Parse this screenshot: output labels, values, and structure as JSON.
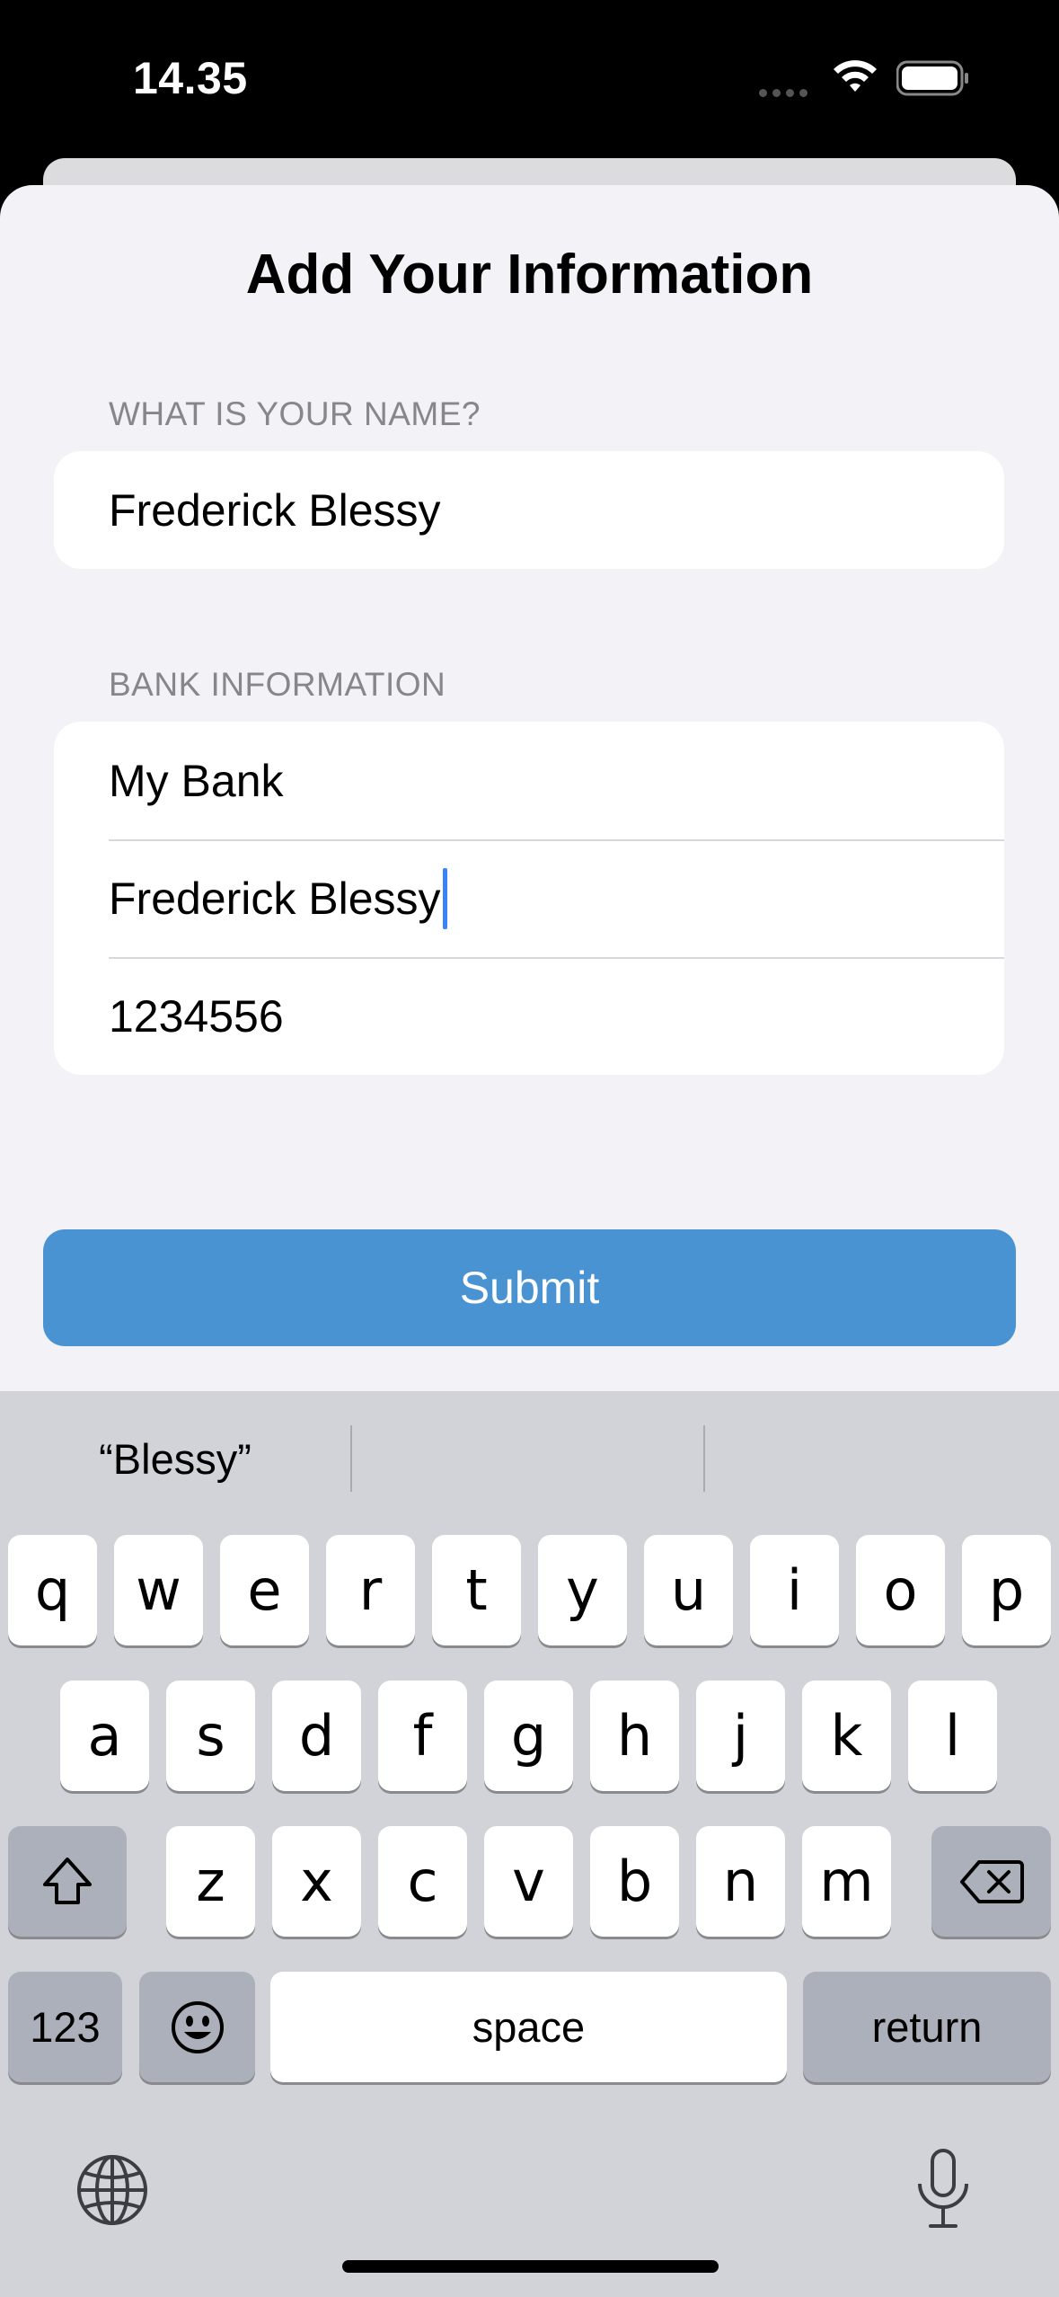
{
  "status": {
    "time": "14.35"
  },
  "page": {
    "title": "Add Your Information"
  },
  "name_section": {
    "header": "WHAT IS YOUR NAME?",
    "name_value": "Frederick Blessy"
  },
  "bank_section": {
    "header": "BANK INFORMATION",
    "bank_name": "My Bank",
    "account_holder": "Frederick Blessy",
    "account_number": "1234556"
  },
  "submit": {
    "label": "Submit"
  },
  "keyboard": {
    "suggestions": [
      "“Blessy”",
      "",
      ""
    ],
    "row1": [
      "q",
      "w",
      "e",
      "r",
      "t",
      "y",
      "u",
      "i",
      "o",
      "p"
    ],
    "row2": [
      "a",
      "s",
      "d",
      "f",
      "g",
      "h",
      "j",
      "k",
      "l"
    ],
    "row3": [
      "z",
      "x",
      "c",
      "v",
      "b",
      "n",
      "m"
    ],
    "numbers_label": "123",
    "space_label": "space",
    "return_label": "return"
  },
  "colors": {
    "accent": "#4a93d2",
    "cursor": "#3a82f7",
    "keyboard_bg": "#d1d3d9"
  }
}
